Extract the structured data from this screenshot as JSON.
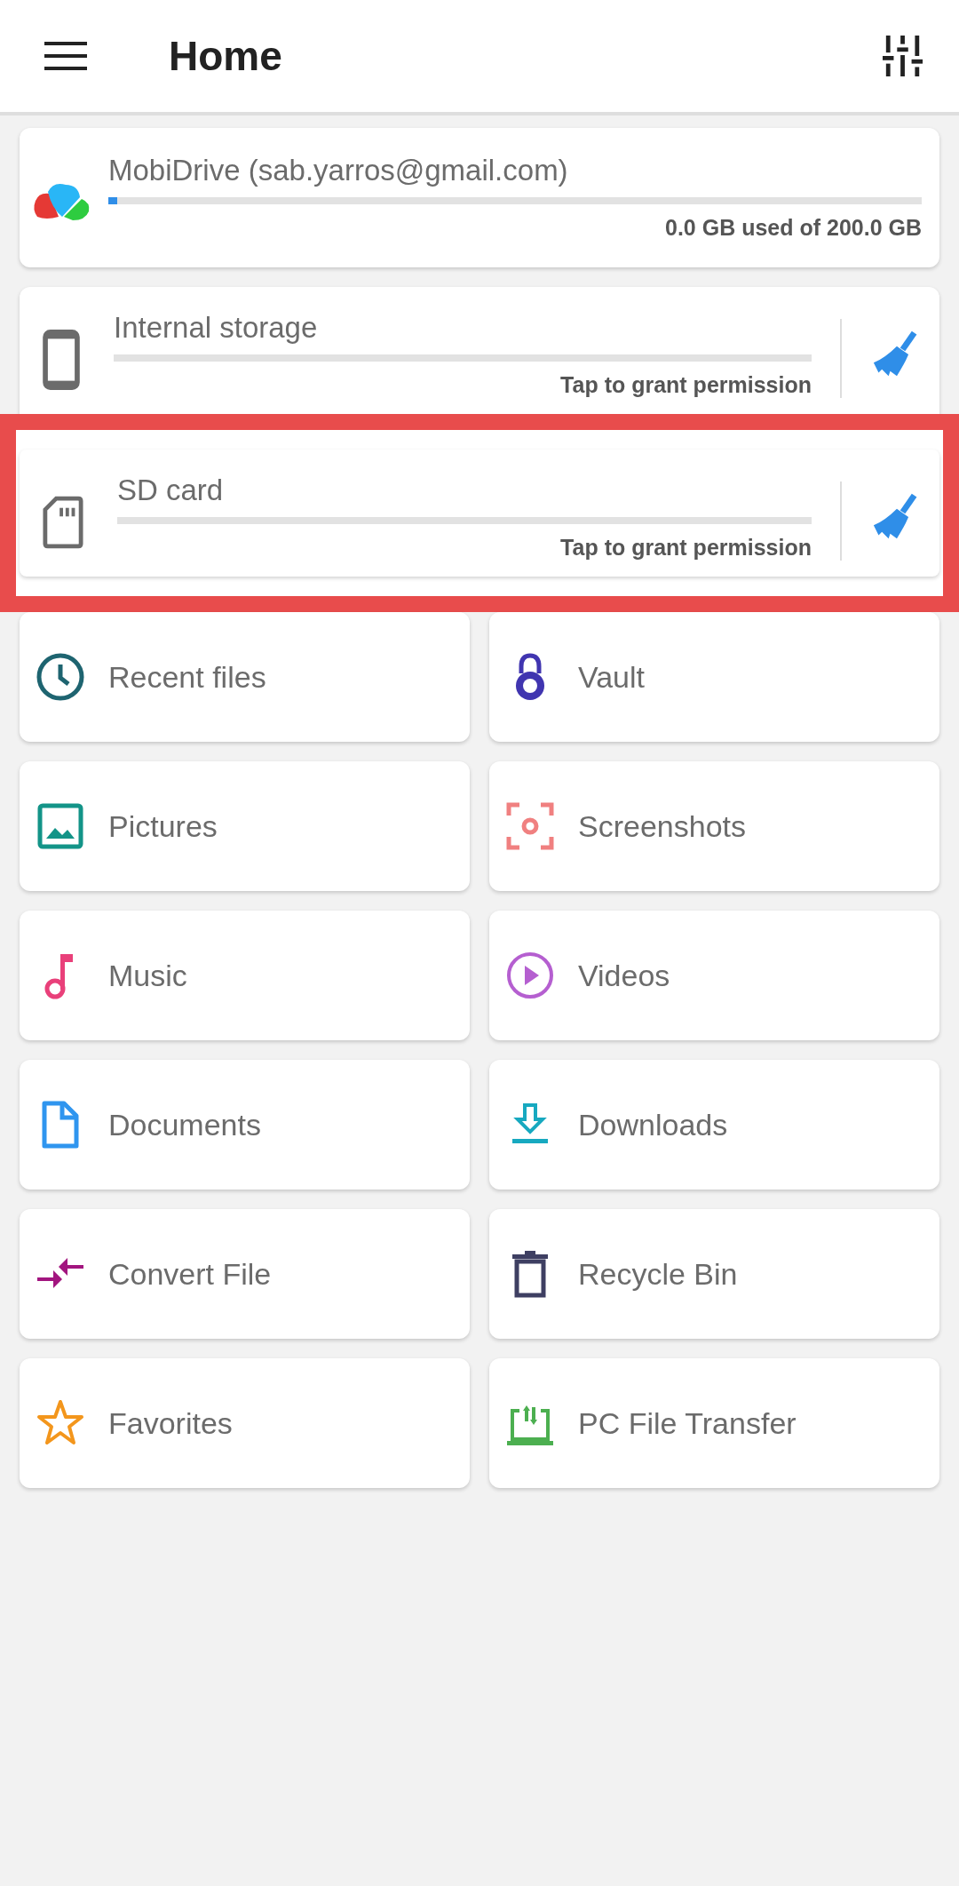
{
  "header": {
    "title": "Home"
  },
  "cloud": {
    "name": "MobiDrive (sab.yarros@gmail.com)",
    "level": 0.01,
    "usage": "0.0 GB used of 200.0 GB"
  },
  "storages": [
    {
      "kind": "phone",
      "name": "Internal storage",
      "status": "Tap to grant permission",
      "highlighted": false
    },
    {
      "kind": "sdcard",
      "name": "SD card",
      "status": "Tap to grant permission",
      "highlighted": true
    }
  ],
  "tiles": [
    {
      "kind": "clock",
      "label": "Recent files",
      "color": "#1e6470"
    },
    {
      "kind": "lock",
      "label": "Vault",
      "color": "#4035b0"
    },
    {
      "kind": "image",
      "label": "Pictures",
      "color": "#139488"
    },
    {
      "kind": "screenshot",
      "label": "Screenshots",
      "color": "#f08080"
    },
    {
      "kind": "note",
      "label": "Music",
      "color": "#e9407a"
    },
    {
      "kind": "play",
      "label": "Videos",
      "color": "#b55fd0"
    },
    {
      "kind": "doc",
      "label": "Documents",
      "color": "#2f95ef"
    },
    {
      "kind": "download",
      "label": "Downloads",
      "color": "#17a9c0"
    },
    {
      "kind": "convert",
      "label": "Convert File",
      "color": "#a2157f"
    },
    {
      "kind": "trash",
      "label": "Recycle Bin",
      "color": "#3e3f62"
    },
    {
      "kind": "star",
      "label": "Favorites",
      "color": "#f3961c"
    },
    {
      "kind": "transfer",
      "label": "PC File Transfer",
      "color": "#4caf50"
    }
  ]
}
